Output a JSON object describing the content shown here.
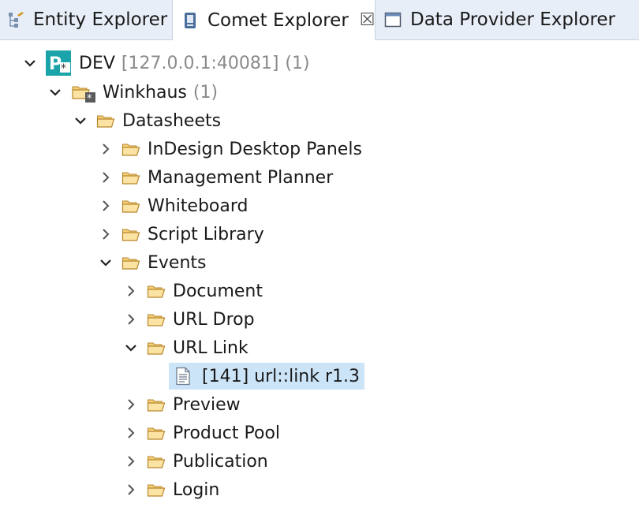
{
  "tabs": [
    {
      "label": "Entity Explorer",
      "icon": "entity-explorer-icon",
      "active": false
    },
    {
      "label": "Comet Explorer",
      "icon": "comet-explorer-icon",
      "active": true,
      "close_glyph": "☒"
    },
    {
      "label": "Data Provider Explorer",
      "icon": "window-icon",
      "active": false
    }
  ],
  "tree": {
    "server": {
      "name": "DEV",
      "address": "[127.0.0.1:40081]",
      "count": "(1)",
      "expanded": true
    },
    "project": {
      "name": "Winkhaus",
      "count": "(1)",
      "expanded": true
    },
    "datasheets": {
      "name": "Datasheets",
      "expanded": true
    },
    "folders_level3": [
      {
        "name": "InDesign Desktop Panels",
        "expanded": false
      },
      {
        "name": "Management Planner",
        "expanded": false
      },
      {
        "name": "Whiteboard",
        "expanded": false
      },
      {
        "name": "Script Library",
        "expanded": false
      },
      {
        "name": "Events",
        "expanded": true
      }
    ],
    "event_folders": [
      {
        "name": "Document",
        "expanded": false
      },
      {
        "name": "URL Drop",
        "expanded": false
      },
      {
        "name": "URL Link",
        "expanded": true
      },
      {
        "name": "Preview",
        "expanded": false
      },
      {
        "name": "Product Pool",
        "expanded": false
      },
      {
        "name": "Publication",
        "expanded": false
      },
      {
        "name": "Login",
        "expanded": false
      }
    ],
    "script_item": {
      "name": "[141] url::link r1.3",
      "selected": true
    }
  },
  "colors": {
    "tab_bar": "#e8eef7",
    "selection": "#cce4f7",
    "folder_fill": "#fbe3a4",
    "folder_stroke": "#b8862b",
    "server_icon": "#1aa3a8"
  }
}
